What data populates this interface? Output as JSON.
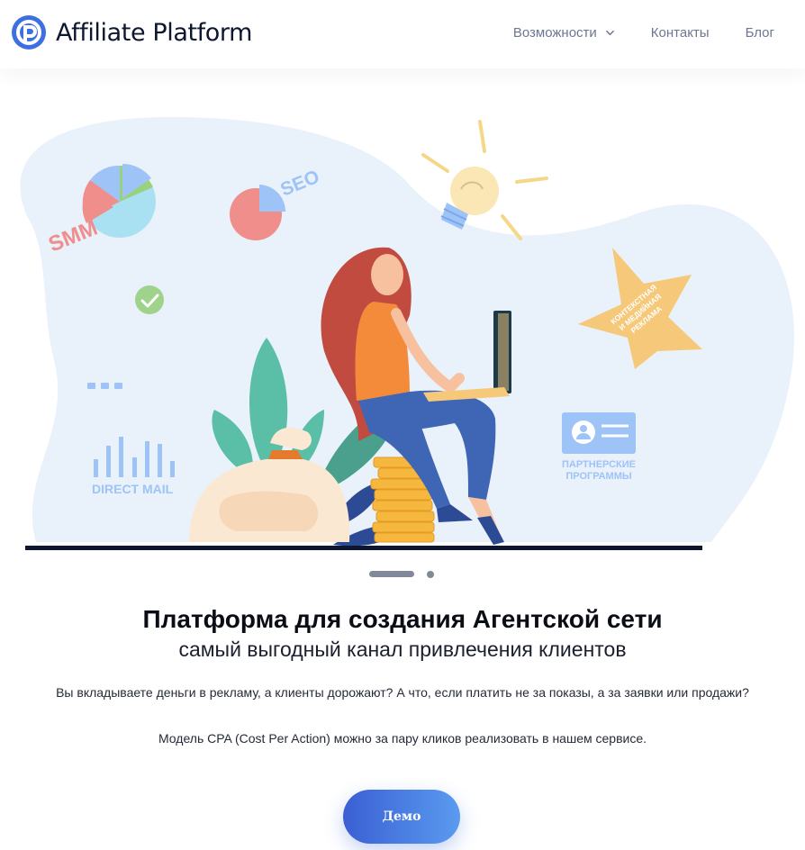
{
  "header": {
    "logo_text": "Affiliate Platform",
    "nav": [
      {
        "label": "Возможности",
        "has_dropdown": true
      },
      {
        "label": "Контакты"
      },
      {
        "label": "Блог"
      }
    ]
  },
  "hero": {
    "labels": {
      "smm": "SMM",
      "seo": "SEO",
      "direct_mail": "DIRECT MAIL",
      "partner_line1": "ПАРТНЕРСКИЕ",
      "partner_line2": "ПРОГРАММЫ",
      "star_line1": "КОНТЕКСТНАЯ",
      "star_line2": "И МЕДИЙНАЯ",
      "star_line3": "РЕКЛАМА"
    },
    "carousel": {
      "slides": 2,
      "active": 1
    }
  },
  "content": {
    "title": "Платформа для создания Агентской сети",
    "subtitle": "самый выгодный канал привлечения клиентов",
    "paragraph1": "Вы вкладываете деньги в рекламу, а клиенты дорожают? А что, если платить не за показы, а за заявки или продажи?",
    "paragraph2": "Модель CPA (Cost Per Action) можно за пару кликов реализовать в нашем сервисе."
  },
  "cta": {
    "label": "Демо"
  },
  "colors": {
    "brand": "#3f63d6",
    "blob": "#e9f1fb",
    "accent_yellow": "#f6c879",
    "nav_text": "#6c7690"
  }
}
